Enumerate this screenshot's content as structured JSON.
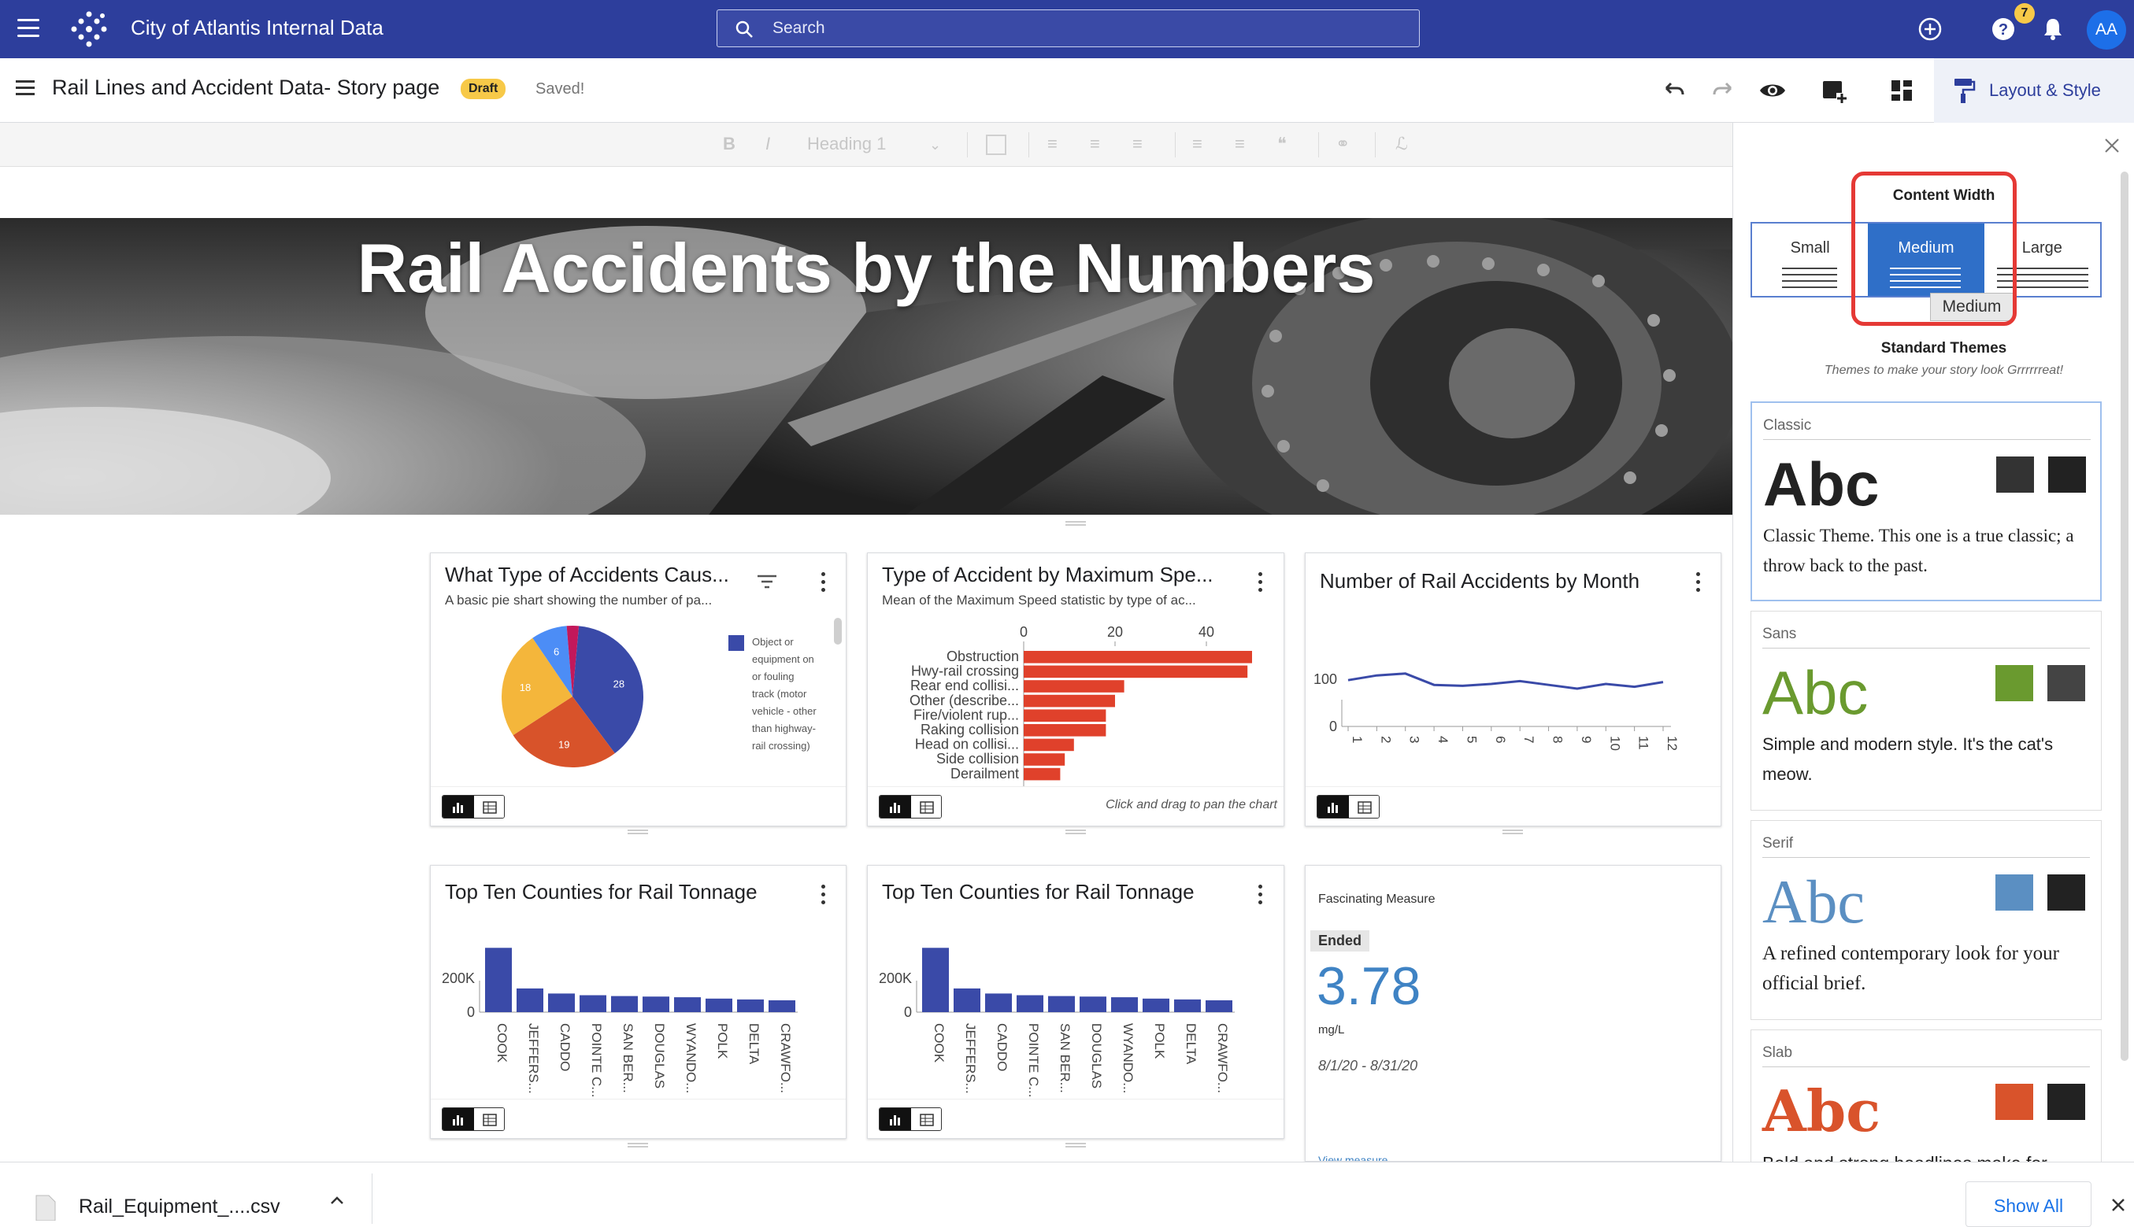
{
  "app": {
    "title": "City of Atlantis Internal Data"
  },
  "search": {
    "placeholder": "Search"
  },
  "header": {
    "notification_badge": "7",
    "avatar_initials": "AA"
  },
  "story": {
    "title": "Rail Lines and Accident Data- Story page",
    "status_badge": "Draft",
    "save_status": "Saved!"
  },
  "toolbar": {
    "layout_style_label": "Layout & Style",
    "heading_select": "Heading 1",
    "bold": "B",
    "italic": "I"
  },
  "hero": {
    "title": "Rail Accidents by the Numbers"
  },
  "cards": {
    "pie": {
      "title": "What Type of Accidents Caus...",
      "subtitle": "A basic pie shart showing the number of pa...",
      "legend_text": [
        "Object or",
        "equipment on",
        "or fouling",
        "track (motor",
        "vehicle - other",
        "than highway-",
        "rail crossing)"
      ]
    },
    "speed": {
      "title": "Type of Accident by Maximum Spe...",
      "subtitle": "Mean of the Maximum Speed statistic by type of ac...",
      "footer_hint": "Click and drag to pan the chart"
    },
    "month": {
      "title": "Number of Rail Accidents by Month"
    },
    "tonnage1": {
      "title": "Top Ten Counties for Rail Tonnage"
    },
    "tonnage2": {
      "title": "Top Ten Counties for Rail Tonnage"
    },
    "measure": {
      "title": "Fascinating Measure",
      "status": "Ended",
      "value": "3.78",
      "unit": "mg/L",
      "date_range": "8/1/20 - 8/31/20",
      "link": "View measure"
    }
  },
  "chart_data": [
    {
      "type": "pie",
      "labels": [
        "28",
        "19",
        "18",
        "6",
        ""
      ],
      "values": [
        28,
        19,
        18,
        6,
        2
      ],
      "colors": [
        "#3a4aa8",
        "#d8532a",
        "#f4b63b",
        "#4c8df6",
        "#c2185b"
      ]
    },
    {
      "type": "bar",
      "orientation": "horizontal",
      "categories": [
        "Obstruction",
        "Hwy-rail crossing",
        "Rear end collisi...",
        "Other (describe...",
        "Fire/violent rup...",
        "Raking collision",
        "Head on collisi...",
        "Side collision",
        "Derailment"
      ],
      "values": [
        50,
        49,
        22,
        20,
        18,
        18,
        11,
        9,
        8
      ],
      "x_ticks": [
        "0",
        "20",
        "40"
      ],
      "xlim": [
        0,
        50
      ],
      "color": "#e0412b"
    },
    {
      "type": "line",
      "x": [
        "1",
        "2",
        "3",
        "4",
        "5",
        "6",
        "7",
        "8",
        "9",
        "10",
        "11",
        "12"
      ],
      "values": [
        98,
        108,
        112,
        88,
        86,
        90,
        96,
        88,
        80,
        90,
        84,
        94
      ],
      "y_ticks": [
        "100",
        "0"
      ],
      "ylim": [
        0,
        200
      ],
      "color": "#3a4aa8"
    },
    {
      "type": "bar",
      "categories": [
        "COOK",
        "JEFFERS...",
        "CADDO",
        "POINTE C...",
        "SAN BER...",
        "DOUGLAS",
        "WYANDO...",
        "POLK",
        "DELTA",
        "CRAWFO..."
      ],
      "values": [
        380,
        140,
        110,
        100,
        95,
        92,
        88,
        80,
        75,
        70
      ],
      "y_ticks": [
        "200K",
        "0"
      ],
      "ylim": [
        0,
        400
      ],
      "color": "#3a4aa8"
    },
    {
      "type": "bar",
      "categories": [
        "COOK",
        "JEFFERS...",
        "CADDO",
        "POINTE C...",
        "SAN BER...",
        "DOUGLAS",
        "WYANDO...",
        "POLK",
        "DELTA",
        "CRAWFO..."
      ],
      "values": [
        380,
        140,
        110,
        100,
        95,
        92,
        88,
        80,
        75,
        70
      ],
      "y_ticks": [
        "200K",
        "0"
      ],
      "ylim": [
        0,
        400
      ],
      "color": "#3a4aa8"
    }
  ],
  "panel": {
    "content_width_label": "Content Width",
    "width_options": [
      "Small",
      "Medium",
      "Large"
    ],
    "selected_width": "Medium",
    "tooltip": "Medium",
    "standard_themes_label": "Standard Themes",
    "standard_themes_sub": "Themes to make your story look Grrrrrreat!",
    "themes": [
      {
        "name": "Classic",
        "sample": "Abc",
        "description": "Classic Theme. This one is a true classic; a throw back to the past.",
        "accent": "#333333",
        "secondary": "#222222"
      },
      {
        "name": "Sans",
        "sample": "Abc",
        "description": "Simple and modern style. It's the cat's meow.",
        "accent": "#6a9a2f",
        "secondary": "#444444"
      },
      {
        "name": "Serif",
        "sample": "Abc",
        "description": "A refined contemporary look for your official brief.",
        "accent": "#5b8fc2",
        "secondary": "#222222"
      },
      {
        "name": "Slab",
        "sample": "Abc",
        "description": "Bold and strong headlines make for",
        "accent": "#d9532b",
        "secondary": "#222222"
      }
    ]
  },
  "downloads": {
    "file_name": "Rail_Equipment_....csv",
    "show_all_label": "Show All"
  }
}
